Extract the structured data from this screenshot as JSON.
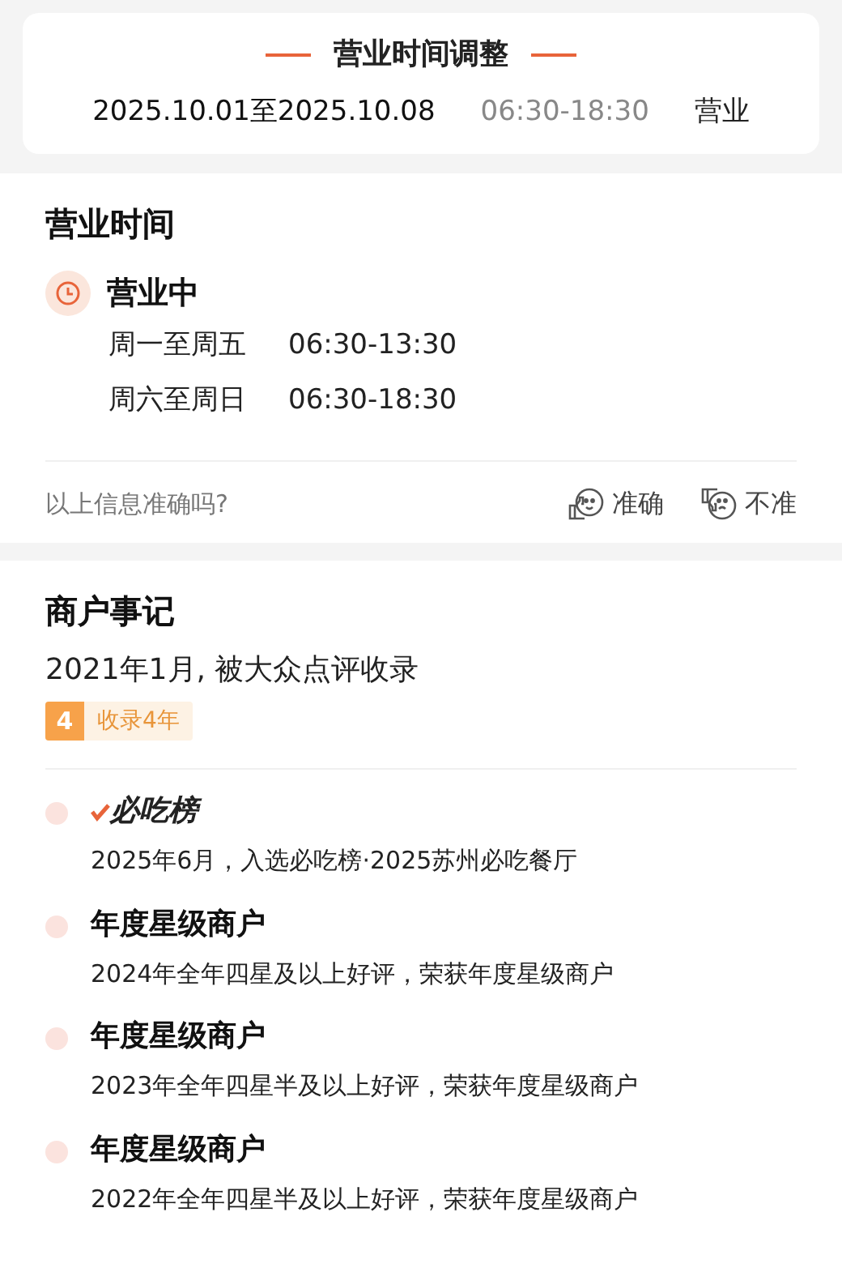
{
  "adjustment": {
    "title": "营业时间调整",
    "dates": "2025.10.01至2025.10.08",
    "hours": "06:30-18:30",
    "status": "营业"
  },
  "hours_section": {
    "title": "营业时间",
    "status": "营业中",
    "rows": [
      {
        "days": "周一至周五",
        "time": "06:30-13:30"
      },
      {
        "days": "周六至周日",
        "time": "06:30-18:30"
      }
    ],
    "feedback_question": "以上信息准确吗?",
    "feedback_buttons": [
      {
        "kind": "up",
        "label": "准确"
      },
      {
        "kind": "down",
        "label": "不准"
      }
    ]
  },
  "history": {
    "title": "商户事记",
    "since": "2021年1月, 被大众点评收录",
    "badge_number": "4",
    "badge_text": "收录4年",
    "events": [
      {
        "kind": "logo",
        "title": "必吃榜",
        "detail": "2025年6月，入选必吃榜·2025苏州必吃餐厅"
      },
      {
        "kind": "title",
        "title": "年度星级商户",
        "detail": "2024年全年四星及以上好评，荣获年度星级商户"
      },
      {
        "kind": "title",
        "title": "年度星级商户",
        "detail": "2023年全年四星半及以上好评，荣获年度星级商户"
      },
      {
        "kind": "title",
        "title": "年度星级商户",
        "detail": "2022年全年四星半及以上好评，荣获年度星级商户"
      }
    ]
  }
}
